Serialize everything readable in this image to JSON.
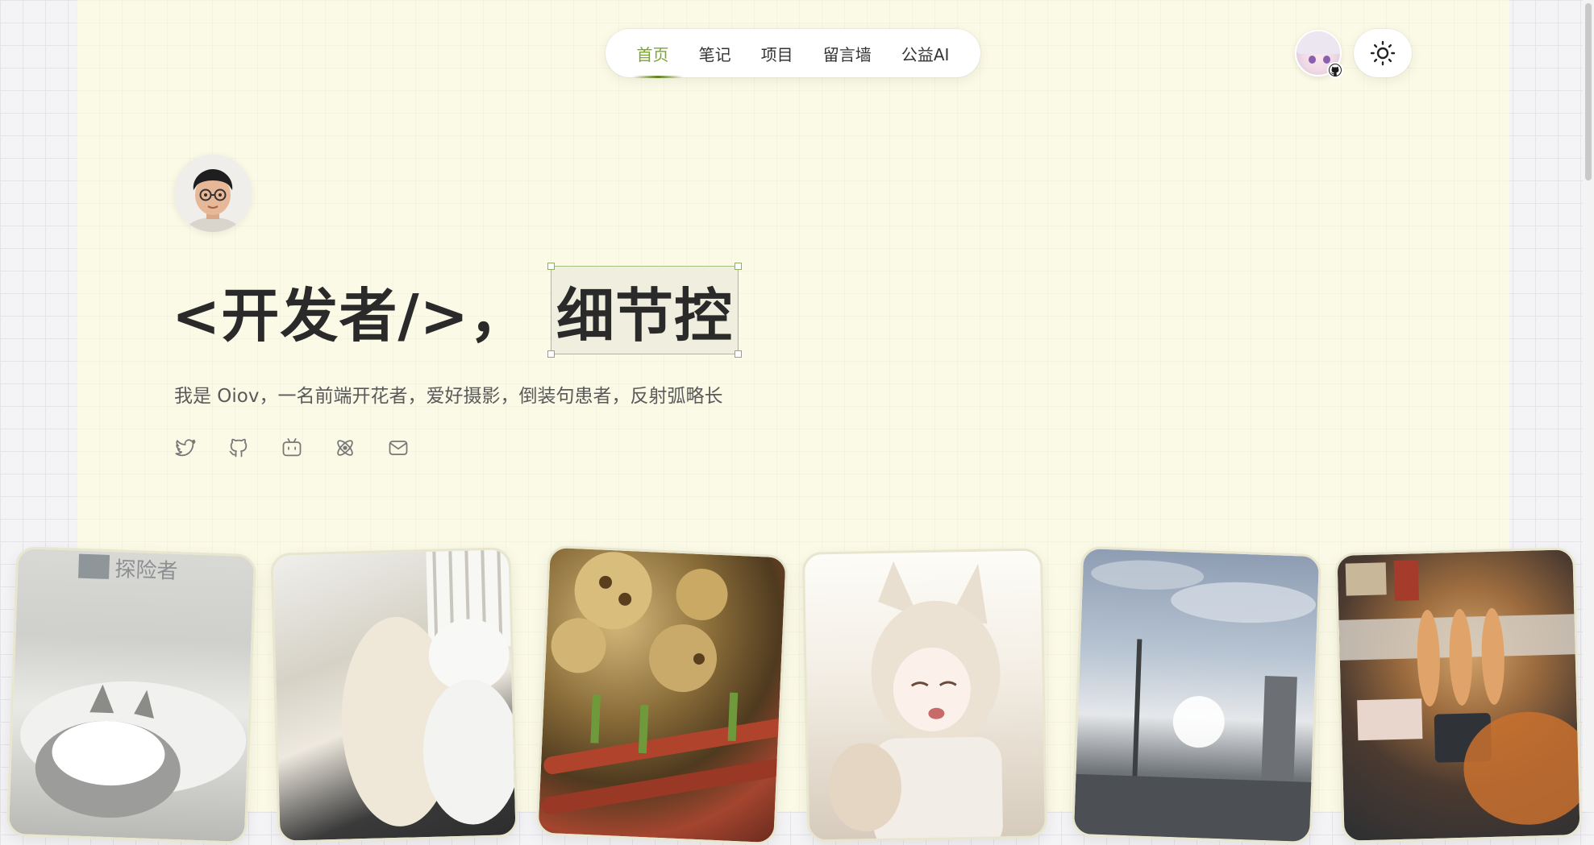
{
  "nav": {
    "items": [
      {
        "label": "首页",
        "active": true
      },
      {
        "label": "笔记",
        "active": false
      },
      {
        "label": "项目",
        "active": false
      },
      {
        "label": "留言墙",
        "active": false
      },
      {
        "label": "公益AI",
        "active": false
      }
    ]
  },
  "header_actions": {
    "github_avatar_icon": "github-icon",
    "theme_toggle_icon": "sun-icon"
  },
  "hero": {
    "title_prefix": "<开发者/>，",
    "title_highlight": "细节控",
    "subtitle": "我是 Oiov，一名前端开花者，爱好摄影，倒装句患者，反射弧略长"
  },
  "socials": [
    {
      "name": "twitter-icon"
    },
    {
      "name": "github-icon"
    },
    {
      "name": "bilibili-icon"
    },
    {
      "name": "react-icon"
    },
    {
      "name": "mail-icon"
    }
  ],
  "photos": [
    {
      "subject": "cat",
      "caption_text": "探险者"
    },
    {
      "subject": "dogs"
    },
    {
      "subject": "food"
    },
    {
      "subject": "anime"
    },
    {
      "subject": "sky"
    },
    {
      "subject": "bbq"
    }
  ],
  "colors": {
    "accent": "#7aa62a",
    "page_bg": "#fbfae6",
    "text": "#2a2a2a",
    "highlight_border": "#a6c17a"
  }
}
